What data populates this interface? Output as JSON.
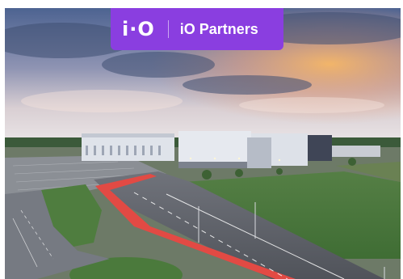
{
  "badge": {
    "logo": "i·O",
    "name": "iO Partners",
    "color": "#8a3ee0"
  },
  "photo": {
    "sky_top": "#5b6f97",
    "sky_sunset": "#f2a25a",
    "grass": "#4a7a3a",
    "road_red": "#e0443f",
    "asphalt": "#5d6068"
  }
}
